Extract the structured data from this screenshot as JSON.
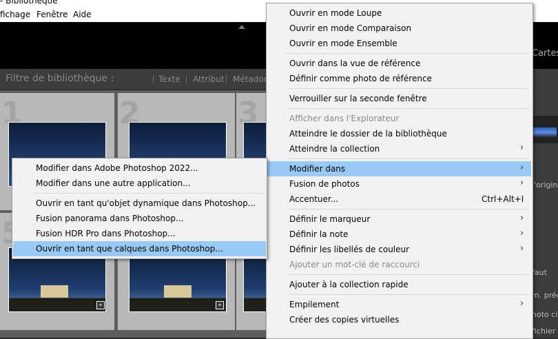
{
  "window": {
    "title_fragment": "- Bibliothèque"
  },
  "menubar": {
    "items": [
      "fichage",
      "Fenêtre",
      "Aide"
    ]
  },
  "topbar": {
    "module_partial": "Cartes"
  },
  "filter_bar": {
    "title": "Filtre de bibliothèque :",
    "options": [
      "Texte",
      "Attribut",
      "Métadonn"
    ]
  },
  "grid": {
    "cell_numbers": [
      "1",
      "2",
      "3",
      "5"
    ]
  },
  "right_panel": {
    "fragments": [
      "l'origine",
      "faut",
      "m. préc",
      "hoto cib",
      "fichier"
    ]
  },
  "context_menu": {
    "items": [
      {
        "label": "Ouvrir en mode Loupe",
        "enabled": true
      },
      {
        "label": "Ouvrir en mode Comparaison",
        "enabled": true
      },
      {
        "label": "Ouvrir en mode Ensemble",
        "enabled": true
      },
      {
        "label": "Ouvrir dans la vue de référence",
        "enabled": true
      },
      {
        "label": "Définir comme photo de référence",
        "enabled": true
      },
      {
        "label": "Verrouiller sur la seconde fenêtre",
        "enabled": true
      },
      {
        "label": "Afficher dans l'Explorateur",
        "enabled": false
      },
      {
        "label": "Atteindre le dossier de la bibliothèque",
        "enabled": true
      },
      {
        "label": "Atteindre la collection",
        "enabled": true,
        "submenu": true
      },
      {
        "label": "Modifier dans",
        "enabled": true,
        "submenu": true,
        "highlighted": true
      },
      {
        "label": "Fusion de photos",
        "enabled": true,
        "submenu": true
      },
      {
        "label": "Accentuer...",
        "enabled": true,
        "shortcut": "Ctrl+Alt+I"
      },
      {
        "label": "Définir le marqueur",
        "enabled": true,
        "submenu": true
      },
      {
        "label": "Définir la note",
        "enabled": true,
        "submenu": true
      },
      {
        "label": "Définir les libellés de couleur",
        "enabled": true,
        "submenu": true
      },
      {
        "label": "Ajouter un mot-clé de raccourci",
        "enabled": false
      },
      {
        "label": "Ajouter à la collection rapide",
        "enabled": true
      },
      {
        "label": "Empilement",
        "enabled": true,
        "submenu": true
      },
      {
        "label": "Créer des copies virtuelles",
        "enabled": true
      }
    ]
  },
  "submenu": {
    "items": [
      {
        "label": "Modifier dans Adobe Photoshop 2022..."
      },
      {
        "label": "Modifier dans une autre application..."
      },
      {
        "label": "Ouvrir en tant qu'objet dynamique dans Photoshop..."
      },
      {
        "label": "Fusion panorama dans Photoshop..."
      },
      {
        "label": "Fusion HDR Pro dans Photoshop..."
      },
      {
        "label": "Ouvrir en tant que calques dans Photoshop...",
        "highlighted": true
      }
    ]
  }
}
